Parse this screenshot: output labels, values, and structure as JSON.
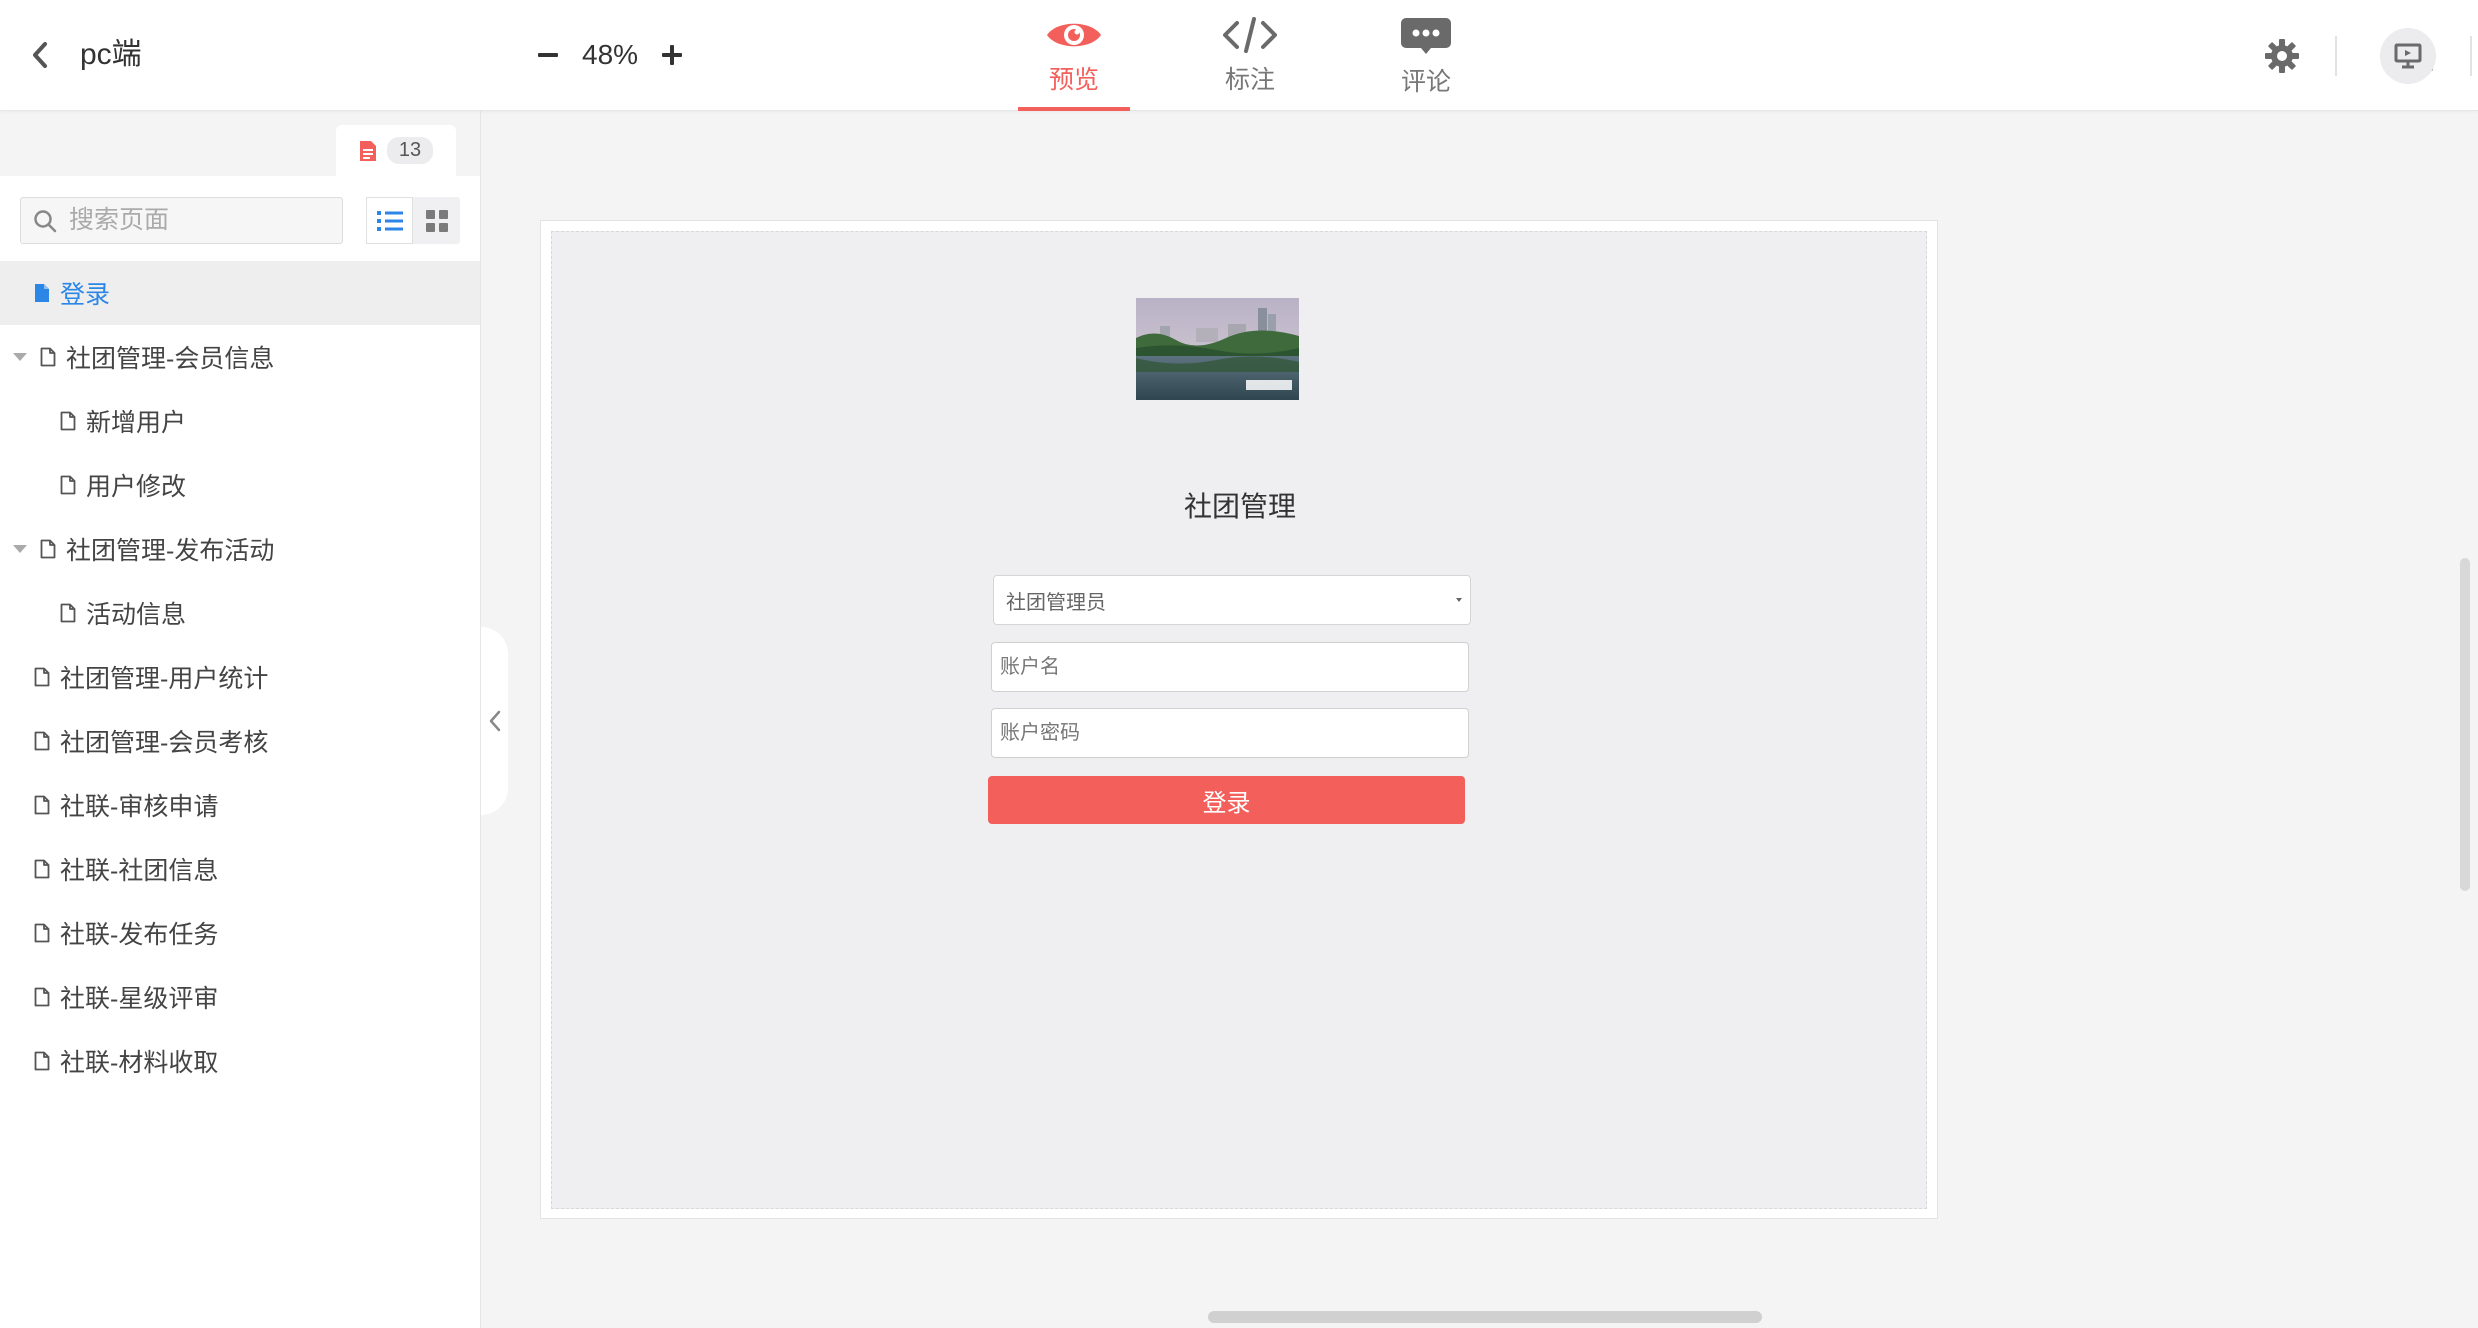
{
  "header": {
    "project_title": "pc端",
    "zoom_level": "48%",
    "tabs": [
      {
        "label": "预览",
        "icon": "eye-icon",
        "active": true
      },
      {
        "label": "标注",
        "icon": "code-icon",
        "active": false
      },
      {
        "label": "评论",
        "icon": "comment-icon",
        "active": false
      }
    ],
    "tools": [
      "settings-icon",
      "share-icon",
      "present-icon"
    ]
  },
  "sidebar": {
    "page_count": "13",
    "search_placeholder": "搜索页面",
    "pages": [
      {
        "label": "登录",
        "level": 0,
        "active": true
      },
      {
        "label": "社团管理-会员信息",
        "level": 0,
        "expanded": true
      },
      {
        "label": "新增用户",
        "level": 1
      },
      {
        "label": "用户修改",
        "level": 1
      },
      {
        "label": "社团管理-发布活动",
        "level": 0,
        "expanded": true
      },
      {
        "label": "活动信息",
        "level": 1
      },
      {
        "label": "社团管理-用户统计",
        "level": 0
      },
      {
        "label": "社团管理-会员考核",
        "level": 0
      },
      {
        "label": "社联-审核申请",
        "level": 0
      },
      {
        "label": "社联-社团信息",
        "level": 0
      },
      {
        "label": "社联-发布任务",
        "level": 0
      },
      {
        "label": "社联-星级评审",
        "level": 0
      },
      {
        "label": "社联-材料收取",
        "level": 0
      }
    ]
  },
  "artboard": {
    "title": "社团管理",
    "role_select_value": "社团管理员",
    "account_placeholder": "账户名",
    "password_placeholder": "账户密码",
    "login_button": "登录"
  },
  "colors": {
    "accent": "#f35f5b",
    "link_blue": "#2b86e6"
  }
}
